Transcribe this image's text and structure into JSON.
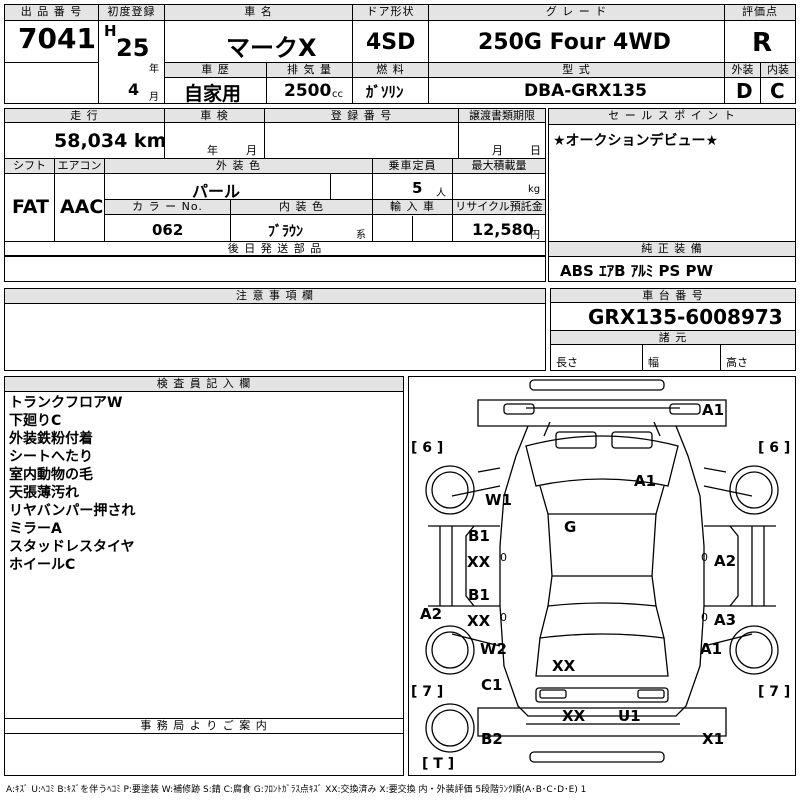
{
  "top": {
    "lot_no_label": "出 品 番 号",
    "lot_no": "7041",
    "first_reg_label": "初度登録",
    "era": "H",
    "year": "25",
    "year_unit": "年",
    "month": "4",
    "month_unit": "月",
    "car_name_label": "車 名",
    "car_name": "マークX",
    "door_label": "ドア形状",
    "door": "4SD",
    "grade_label": "グ レ ー ド",
    "grade": "250G Four 4WD",
    "score_label": "評価点",
    "score": "R",
    "history_label": "車 歴",
    "history": "自家用",
    "displacement_label": "排 気 量",
    "displacement": "2500",
    "displacement_unit": "cc",
    "fuel_label": "燃 料",
    "fuel": "ｶﾞｿﾘﾝ",
    "model_label": "型 式",
    "model": "DBA-GRX135",
    "ext_label": "外装",
    "ext_grade": "D",
    "int_label": "内装",
    "int_grade": "C"
  },
  "mid": {
    "mileage_label": "走 行",
    "mileage": "58,034 km",
    "inspection_label": "車 検",
    "insp_year_unit": "年",
    "insp_month_unit": "月",
    "plate_label": "登 録 番 号",
    "transfer_label": "譲渡書類期限",
    "transfer_month_unit": "月",
    "transfer_day_unit": "日",
    "shift_label": "シフト",
    "shift": "FAT",
    "ac_label": "エアコン",
    "ac": "AAC",
    "ext_color_label": "外 装 色",
    "ext_color": "パール",
    "capacity_label": "乗車定員",
    "capacity": "5",
    "capacity_unit": "人",
    "load_label": "最大積載量",
    "load_unit": "kg",
    "color_no_label": "カ ラ ー No.",
    "color_no": "062",
    "int_color_label": "内 装 色",
    "int_color": "ﾌﾞﾗｳﾝ",
    "int_color_suffix": "系",
    "import_label": "輸 入 車",
    "recycle_label": "リサイクル預託金",
    "recycle": "12,580",
    "recycle_unit": "円",
    "later_parts_label": "後 日 発 送 部 品",
    "sales_label": "セ ー ル ス ポ イ ン ト",
    "sales": "★オークションデビュー★",
    "equip_label": "純 正 装 備",
    "equip": "ABS ｴｱB ｱﾙﾐ PS PW",
    "notes_label": "注 意 事 項 欄",
    "chassis_label": "車 台 番 号",
    "chassis": "GRX135-6008973",
    "dims_label": "諸 元",
    "length": "長さ",
    "width": "幅",
    "height": "高さ"
  },
  "inspector": {
    "label": "検 査 員 記 入 欄",
    "lines": [
      "トランクフロアW",
      "下廻りC",
      "外装鉄粉付着",
      "シートへたり",
      "室内動物の毛",
      "天張薄汚れ",
      "リヤバンパー押され",
      "ミラーA",
      "スタッドレスタイヤ",
      "ホイールC"
    ]
  },
  "office": {
    "label": "事 務 局 よ り ご 案 内"
  },
  "diagram": {
    "tire_rf": "[ 6 ]",
    "tire_lf": "[ 6 ]",
    "tire_rr": "[ 7 ]",
    "tire_lr": "[ 7 ]",
    "spare": "[ T ]",
    "marks": [
      "A1",
      "A1",
      "W1",
      "G",
      "B1",
      "XX",
      "A2",
      "B1",
      "XX",
      "A2",
      "A3",
      "W2",
      "A1",
      "XX",
      "C1",
      "XX",
      "U1",
      "B2",
      "X1"
    ],
    "gauge_zero": "0"
  },
  "legend": "A:ｷｽﾞ  U:ﾍｺﾐ  B:ｷｽﾞを伴うﾍｺﾐ  P:要塗装  W:補修跡  S:錆  C:腐食  G:ﾌﾛﾝﾄｶﾞﾗｽ点ｷｽﾞ  XX:交換済み  X:要交換   内・外装評価  5段階ﾗﾝｸ順(A･B･C･D･E) 1"
}
